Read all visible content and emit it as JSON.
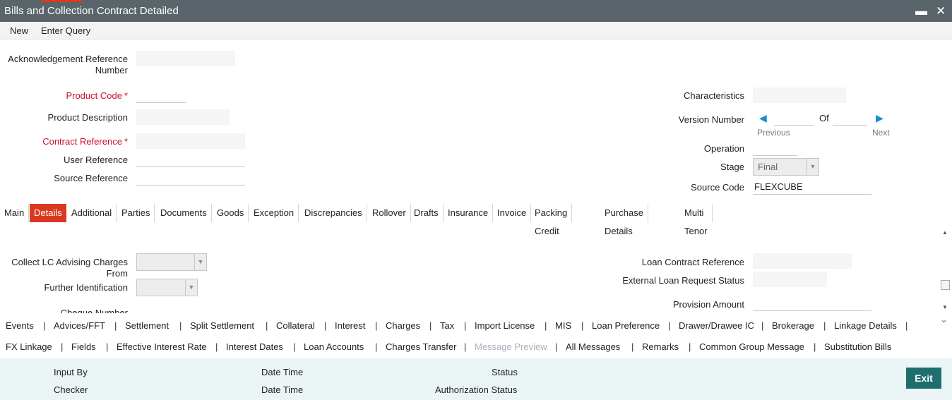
{
  "window": {
    "title": "Bills and Collection Contract Detailed"
  },
  "menu": {
    "new": "New",
    "enter_query": "Enter Query"
  },
  "header": {
    "ack_ref_label": "Acknowledgement Reference Number",
    "product_code_label": "Product Code",
    "product_desc_label": "Product Description",
    "contract_ref_label": "Contract Reference",
    "user_ref_label": "User Reference",
    "source_ref_label": "Source Reference",
    "characteristics_label": "Characteristics",
    "version_number_label": "Version Number",
    "of_label": "Of",
    "previous_label": "Previous",
    "next_label": "Next",
    "operation_label": "Operation",
    "stage_label": "Stage",
    "stage_value": "Final",
    "source_code_label": "Source Code",
    "source_code_value": "FLEXCUBE",
    "required_star": "*"
  },
  "tabs": [
    "Main",
    "Details",
    "Additional",
    "Parties",
    "Documents",
    "Goods",
    "Exception",
    "Discrepancies",
    "Rollover",
    "Drafts",
    "Insurance",
    "Invoice",
    "Packing Credit",
    "Purchase Details",
    "Multi Tenor"
  ],
  "details": {
    "collect_lc_label": "Collect LC Advising Charges From",
    "further_id_label": "Further Identification",
    "cheque_number_label": "Cheque Number",
    "loan_contract_ref_label": "Loan Contract Reference",
    "ext_loan_status_label": "External Loan Request Status",
    "provision_amount_label": "Provision Amount"
  },
  "footer_row1": [
    "Events",
    "Advices/FFT",
    "Settlement",
    "Split Settlement",
    "Collateral",
    "Interest",
    "Charges",
    "Tax",
    "Import License",
    "MIS",
    "Loan Preference",
    "Drawer/Drawee IC",
    "Brokerage",
    "Linkage Details"
  ],
  "footer_row2": [
    "FX Linkage",
    "Fields",
    "Effective Interest Rate",
    "Interest Dates",
    "Loan Accounts",
    "Charges Transfer",
    "Message Preview",
    "All Messages",
    "Remarks",
    "Common Group Message",
    "Substitution Bills"
  ],
  "separator": "|",
  "bottom": {
    "input_by": "Input By",
    "checker": "Checker",
    "date_time": "Date Time",
    "status": "Status",
    "auth_status": "Authorization Status",
    "exit": "Exit"
  },
  "icons": {
    "minimize": "minimize-icon",
    "close": "close-icon",
    "prev": "triangle-left-icon",
    "next": "triangle-right-icon"
  },
  "colors": {
    "titlebar": "#59646b",
    "accent": "#d9391f",
    "link": "#1a8ad2",
    "exit": "#1f6e6e",
    "required": "#c8102e"
  }
}
